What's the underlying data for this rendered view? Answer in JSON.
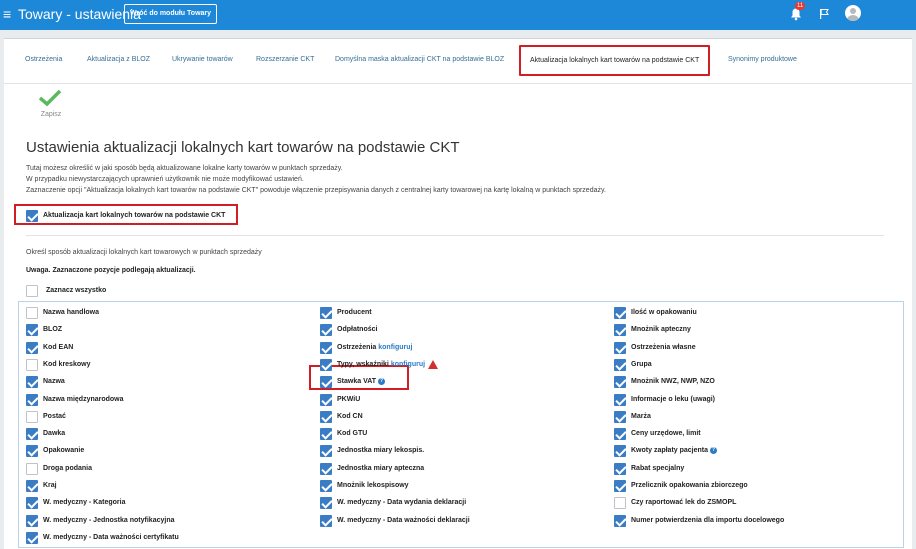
{
  "header": {
    "menu_glyph": "≡",
    "app_title": "Towary - ustawienia",
    "back_button": "Wróć do modułu Towary",
    "notification_count": "11",
    "icons": [
      "menu-icon",
      "bell-icon",
      "flag-icon",
      "user-avatar-icon"
    ],
    "accent_color": "#1e88d8"
  },
  "tabs": [
    {
      "label": "Ostrzeżenia"
    },
    {
      "label": "Aktualizacja z BLOZ"
    },
    {
      "label": "Ukrywanie towarów"
    },
    {
      "label": "Rozszerzanie CKT"
    },
    {
      "label": "Domyślna maska aktualizacji CKT na podstawie BLOZ"
    },
    {
      "label": "Aktualizacja lokalnych kart towarów na podstawie CKT",
      "active": true
    },
    {
      "label": "Synonimy produktowe"
    }
  ],
  "toolbar": {
    "save_label": "Zapisz",
    "save_icon": "checkmark-icon"
  },
  "section": {
    "title": "Ustawienia aktualizacji lokalnych kart towarów na podstawie CKT",
    "desc_lines": [
      "Tutaj możesz określić w jaki sposób będą aktualizowane lokalne karty towarów w punktach sprzedaży.",
      "W przypadku niewystarczających uprawnień użytkownik nie może modyfikować ustawień.",
      "Zaznaczenie opcji \"Aktualizacja lokalnych kart towarów na podstawie CKT\" powoduje włączenie przepisywania danych z centralnej karty towarowej na kartę lokalną w punktach sprzedaży."
    ],
    "main_option": {
      "label": "Aktualizacja kart lokalnych towarów na podstawie CKT",
      "checked": true
    },
    "intro": "Określ sposób aktualizacji lokalnych kart towarowych w punktach sprzedaży",
    "warning": "Uwaga. Zaznaczone pozycje podlegają aktualizacji.",
    "select_all": {
      "label": "Zaznacz wszystko",
      "checked": false
    }
  },
  "fields": {
    "col1": [
      {
        "label": "Nazwa handlowa",
        "checked": false
      },
      {
        "label": "BLOZ",
        "checked": true
      },
      {
        "label": "Kod EAN",
        "checked": true
      },
      {
        "label": "Kod kreskowy",
        "checked": false
      },
      {
        "label": "Nazwa",
        "checked": true
      },
      {
        "label": "Nazwa międzynarodowa",
        "checked": true
      },
      {
        "label": "Postać",
        "checked": false
      },
      {
        "label": "Dawka",
        "checked": true
      },
      {
        "label": "Opakowanie",
        "checked": true
      },
      {
        "label": "Droga podania",
        "checked": false
      },
      {
        "label": "Kraj",
        "checked": true
      },
      {
        "label": "W. medyczny - Kategoria",
        "checked": true
      },
      {
        "label": "W. medyczny - Jednostka notyfikacyjna",
        "checked": true
      },
      {
        "label": "W. medyczny - Data ważności certyfikatu",
        "checked": true
      }
    ],
    "col2": [
      {
        "label": "Producent",
        "checked": true
      },
      {
        "label": "Odpłatności",
        "checked": true
      },
      {
        "label": "Ostrzeżenia",
        "link": "konfiguruj",
        "checked": true
      },
      {
        "label": "Typy, wskaźniki",
        "link": "konfiguruj",
        "warning_icon": "warning-triangle-icon",
        "checked": true
      },
      {
        "label": "Stawka VAT",
        "help_icon": "help-circle-icon",
        "checked": true,
        "highlighted": true
      },
      {
        "label": "PKWiU",
        "checked": true
      },
      {
        "label": "Kod CN",
        "checked": true
      },
      {
        "label": "Kod GTU",
        "checked": true
      },
      {
        "label": "Jednostka miary lekospis.",
        "checked": true
      },
      {
        "label": "Jednostka miary apteczna",
        "checked": true
      },
      {
        "label": "Mnożnik lekospisowy",
        "checked": true
      },
      {
        "label": "W. medyczny - Data wydania deklaracji",
        "checked": true
      },
      {
        "label": "W. medyczny - Data ważności deklaracji",
        "checked": true
      }
    ],
    "col3": [
      {
        "label": "Ilość w opakowaniu",
        "checked": true
      },
      {
        "label": "Mnożnik apteczny",
        "checked": true
      },
      {
        "label": "Ostrzeżenia własne",
        "checked": true
      },
      {
        "label": "Grupa",
        "checked": true
      },
      {
        "label": "Mnożnik NWZ, NWP, NZO",
        "checked": true
      },
      {
        "label": "Informacje o leku (uwagi)",
        "checked": true
      },
      {
        "label": "Marża",
        "checked": true
      },
      {
        "label": "Ceny urzędowe, limit",
        "checked": true
      },
      {
        "label": "Kwoty zapłaty pacjenta",
        "help_icon": "help-circle-icon",
        "checked": true
      },
      {
        "label": "Rabat specjalny",
        "checked": true
      },
      {
        "label": "Przelicznik opakowania zbiorczego",
        "checked": true
      },
      {
        "label": "Czy raportować lek do ZSMOPL",
        "checked": false
      },
      {
        "label": "Numer potwierdzenia dla importu docelowego",
        "checked": true
      }
    ]
  },
  "colors": {
    "checked": "#3b7dc4",
    "highlight": "#cf1f24",
    "link": "#2b7bc7"
  }
}
